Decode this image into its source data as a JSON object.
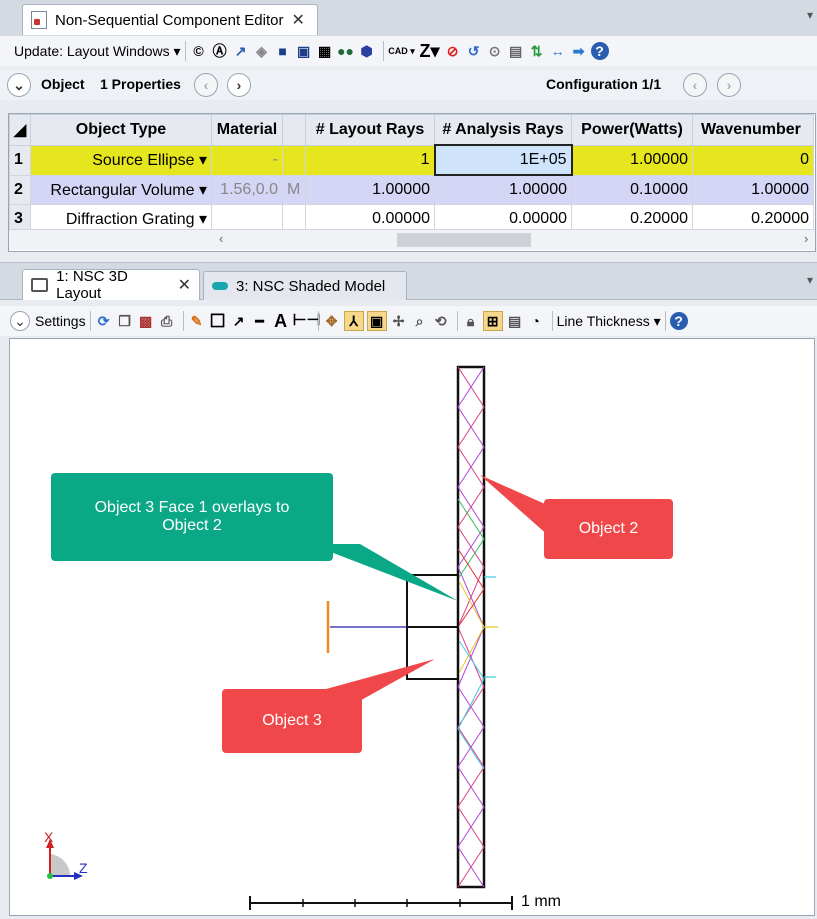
{
  "editor": {
    "tab_title": "Non-Sequential Component Editor",
    "update_label": "Update: Layout Windows",
    "object_label": "Object",
    "properties_label": "1 Properties",
    "configuration_label": "Configuration 1/1",
    "columns": [
      "Object Type",
      "Material",
      "# Layout Rays",
      "# Analysis Rays",
      "Power(Watts)",
      "Wavenumber"
    ],
    "rows": [
      {
        "num": "1",
        "type": "Source Ellipse",
        "material": "-",
        "layout_rays": "1",
        "analysis_rays": "1E+05",
        "power": "1.00000",
        "wavenumber": "0"
      },
      {
        "num": "2",
        "type": "Rectangular Volume",
        "material": "1.56,0.0",
        "material_flag": "M",
        "layout_rays": "1.00000",
        "analysis_rays": "1.00000",
        "power": "0.10000",
        "wavenumber": "1.00000"
      },
      {
        "num": "3",
        "type": "Diffraction Grating",
        "material": "",
        "layout_rays": "0.00000",
        "analysis_rays": "0.00000",
        "power": "0.20000",
        "wavenumber": "0.20000"
      }
    ]
  },
  "layout": {
    "tab1": "1: NSC 3D Layout",
    "tab2": "3: NSC Shaded Model",
    "settings_label": "Settings",
    "line_thickness_label": "Line Thickness",
    "scale_label": "1 mm",
    "axis_x": "X",
    "axis_z": "Z",
    "callouts": {
      "green": "Object 3 Face 1 overlays to Object 2",
      "object2": "Object 2",
      "object3": "Object 3"
    }
  },
  "colors": {
    "row1_highlight": "#e6e61e",
    "row2_highlight": "#d5d5f5",
    "callout_green": "#0aa887",
    "callout_red": "#f0474a"
  }
}
